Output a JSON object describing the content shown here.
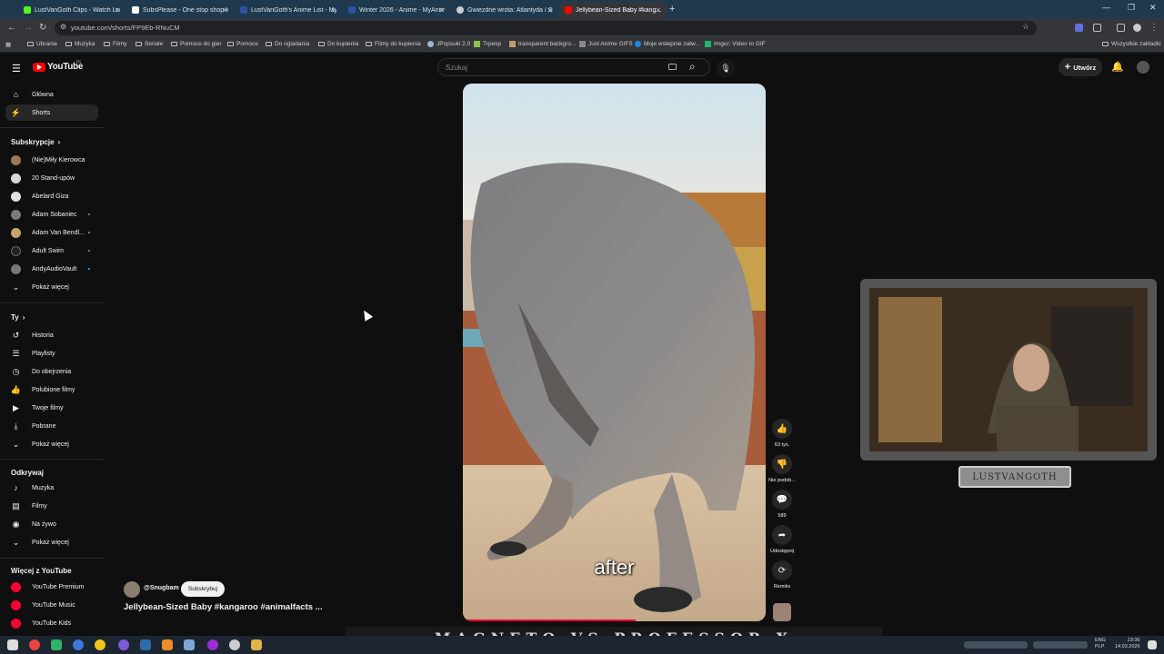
{
  "browser": {
    "tabs": [
      {
        "title": "LustVanGoth Clips - Watch Liv...",
        "color": "#53fc18"
      },
      {
        "title": "SubsPlease - One stop shop fo...",
        "color": "#ffffff"
      },
      {
        "title": "LustVanGoth's Anime List - My...",
        "color": "#2e51a2"
      },
      {
        "title": "Winter 2026 - Anime - MyAnim...",
        "color": "#2e51a2"
      },
      {
        "title": "Gwiezdne wrota: Atlantyda / Su...",
        "color": "#cccccc"
      },
      {
        "title": "Jellybean-Sized Baby #kang...",
        "color": "#ff0000"
      }
    ],
    "url": "youtube.com/shorts/FP9Eb-RNuCM",
    "bookmarks": [
      "Ubrania",
      "Muzyka",
      "Filmy",
      "Seriale",
      "Pomoce do gier",
      "Pomoce",
      "Do ogladania",
      "Do kupienia",
      "Filmy do kupienia",
      "JPopsuki 2.0",
      "Trpesp",
      "transparent backgro...",
      "Just Anime GIFS",
      "Moje wstepnie zatw...",
      "Imgur: Video to GIF"
    ],
    "all_bookmarks": "Wszystkie zakładki"
  },
  "youtube": {
    "logo": "YouTube",
    "country": "PL",
    "search_placeholder": "Szukaj",
    "create_label": "Utwórz",
    "sidebar": {
      "main": [
        {
          "label": "Główna",
          "icon": "home-icon"
        },
        {
          "label": "Shorts",
          "icon": "shorts-icon"
        }
      ],
      "subs_header": "Subskrypcje",
      "subs": [
        {
          "label": "(Nie)Miły Kierowca",
          "color": "#9a7a55"
        },
        {
          "label": "20 Stand-upów",
          "color": "#d8d8d8"
        },
        {
          "label": "Abelard Giza",
          "color": "#e0e0e0"
        },
        {
          "label": "Adam Sobaniec",
          "color": "#7a7a7a"
        },
        {
          "label": "Adam Van Bendl...",
          "color": "#c9a36a"
        },
        {
          "label": "Adult Swim",
          "color": "#222222"
        },
        {
          "label": "AndyAudioVault",
          "color": "#777777"
        }
      ],
      "show_more": "Pokaż więcej",
      "you_header": "Ty",
      "you": [
        {
          "label": "Historia",
          "icon": "history-icon"
        },
        {
          "label": "Playlisty",
          "icon": "playlists-icon"
        },
        {
          "label": "Do obejrzenia",
          "icon": "watch-later-icon"
        },
        {
          "label": "Polubione filmy",
          "icon": "liked-icon"
        },
        {
          "label": "Twoje filmy",
          "icon": "your-videos-icon"
        },
        {
          "label": "Pobrane",
          "icon": "downloads-icon"
        },
        {
          "label": "Pokaż więcej",
          "icon": "chevron-down-icon"
        }
      ],
      "explore_header": "Odkrywaj",
      "explore": [
        {
          "label": "Muzyka",
          "icon": "music-icon"
        },
        {
          "label": "Filmy",
          "icon": "movies-icon"
        },
        {
          "label": "Na żywo",
          "icon": "live-icon"
        },
        {
          "label": "Pokaż więcej",
          "icon": "chevron-down-icon"
        }
      ],
      "more_header": "Więcej z YouTube",
      "more": [
        "YouTube Premium",
        "YouTube Music",
        "YouTube Kids"
      ]
    },
    "short": {
      "caption": "after",
      "channel": "@Snugbam",
      "subscribe": "Subskrybuj",
      "title": "Jellybean-Sized Baby #kangaroo #animalfacts ...",
      "progress": 0.57
    },
    "actions": [
      {
        "label": "63 tys.",
        "icon": "like-icon"
      },
      {
        "label": "Nie podob...",
        "icon": "dislike-icon"
      },
      {
        "label": "589",
        "icon": "comment-icon"
      },
      {
        "label": "Udostępnij",
        "icon": "share-icon"
      },
      {
        "label": "Remiks",
        "icon": "remix-icon"
      }
    ]
  },
  "overlay": {
    "cam_label": "LUSTVANGOTH",
    "banner": "MAGNETO VS PROFESSOR X"
  },
  "taskbar": {
    "lang1": "ENG",
    "lang2": "PLP",
    "time": "23:36",
    "date": "14.03.2026"
  }
}
